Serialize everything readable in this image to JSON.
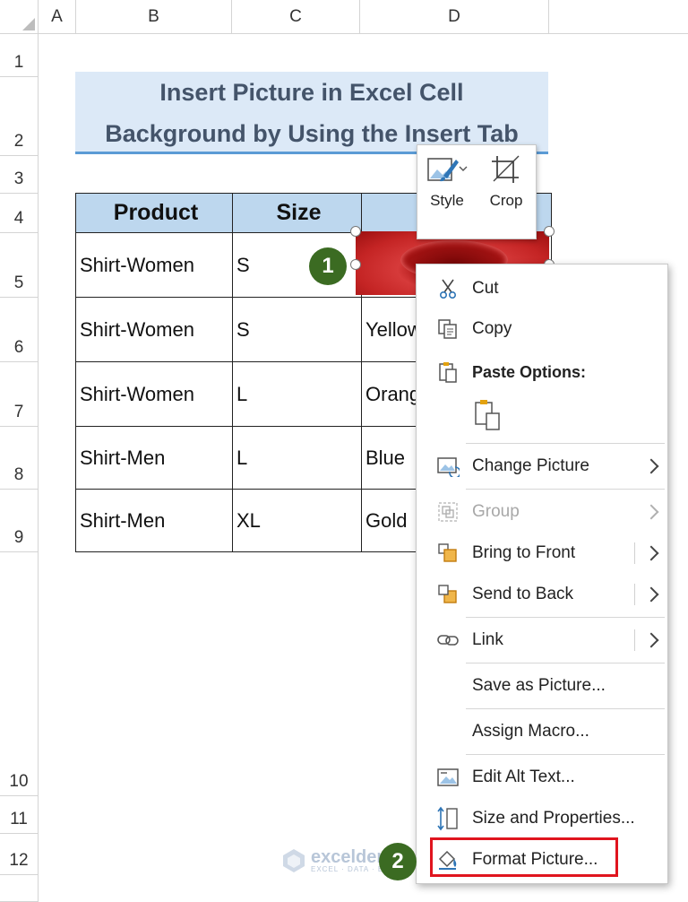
{
  "columns": [
    "A",
    "B",
    "C",
    "D"
  ],
  "rows": [
    "1",
    "2",
    "3",
    "4",
    "5",
    "6",
    "7",
    "8",
    "9",
    "10",
    "11",
    "12"
  ],
  "title": {
    "line1": "Insert Picture in Excel Cell",
    "line2": "Background by Using the Insert Tab"
  },
  "table": {
    "headers": [
      "Product",
      "Size",
      ""
    ],
    "rows": [
      [
        "Shirt-Women",
        "S",
        ""
      ],
      [
        "Shirt-Women",
        "S",
        "Yellow"
      ],
      [
        "Shirt-Women",
        "L",
        "Orange"
      ],
      [
        "Shirt-Men",
        "L",
        "Blue"
      ],
      [
        "Shirt-Men",
        "XL",
        "Gold"
      ]
    ]
  },
  "badges": [
    "1",
    "2"
  ],
  "mini_toolbar": {
    "style_label": "Style",
    "crop_label": "Crop"
  },
  "context_menu": {
    "cut": "Cut",
    "copy": "Copy",
    "paste_options": "Paste Options:",
    "change_picture": "Change Picture",
    "group": "Group",
    "bring_to_front": "Bring to Front",
    "send_to_back": "Send to Back",
    "link": "Link",
    "save_as_picture": "Save as Picture...",
    "assign_macro": "Assign Macro...",
    "edit_alt_text": "Edit Alt Text...",
    "size_and_properties": "Size and Properties...",
    "format_picture": "Format Picture..."
  },
  "watermark": {
    "name": "exceldemy",
    "tagline": "EXCEL · DATA · BI"
  },
  "colors": {
    "header_fill": "#bdd7ee",
    "title_fill": "#dce9f7",
    "badge_green": "#3b6b22",
    "highlight_red": "#e0141e",
    "picture_red": "#c42424"
  }
}
